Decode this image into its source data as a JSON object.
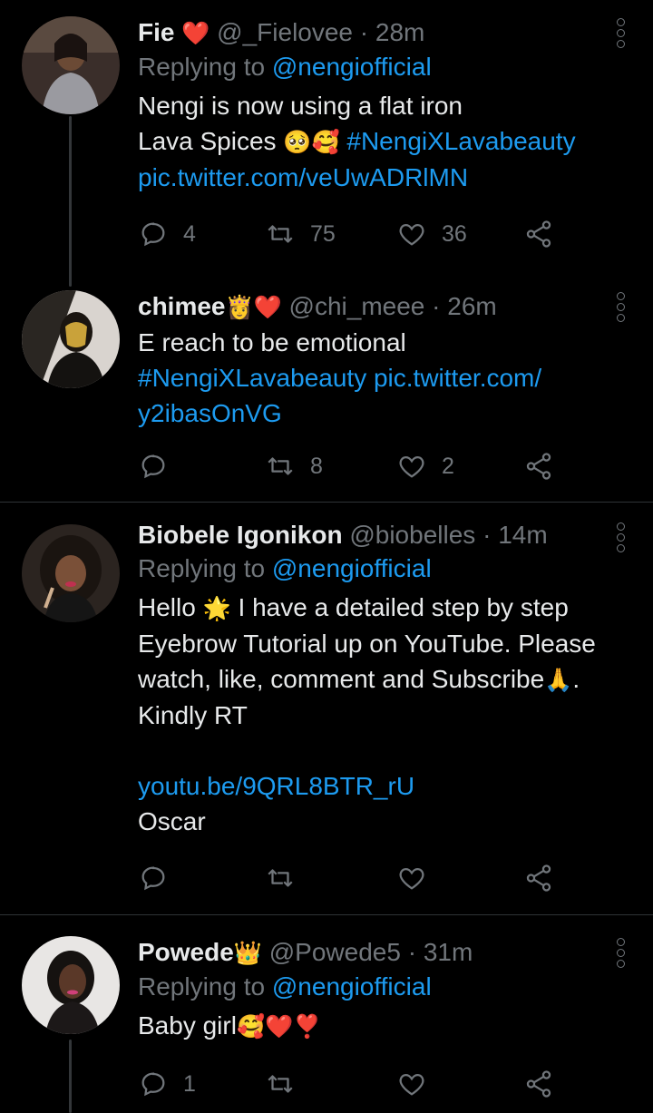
{
  "tweets": [
    {
      "name": "Fie",
      "name_emoji": "❤️",
      "handle": "@_Fielovee",
      "time": "28m",
      "replying_label": "Replying to",
      "replying_to": "@nengiofficial",
      "body_lines": [
        "Nengi is now using a flat iron",
        "Lava Spices"
      ],
      "body_emoji": "🥺🥰",
      "hashtag": "#NengiXLavabeauty",
      "link": "pic.twitter.com/veUwADRlMN",
      "replies": "4",
      "retweets": "75",
      "likes": "36"
    },
    {
      "name": "chimee",
      "name_emoji": "👸❤️",
      "handle": "@chi_meee",
      "time": "26m",
      "body_line1": "E reach to be emotional",
      "hashtag": "#NengiXLavabeauty",
      "link1": "pic.twitter.com/",
      "link2": "y2ibasOnVG",
      "replies": "",
      "retweets": "8",
      "likes": "2"
    },
    {
      "name": "Biobele Igonikon",
      "handle": "@biobelles",
      "time": "14m",
      "replying_label": "Replying to",
      "replying_to": "@nengiofficial",
      "line1_a": "Hello",
      "line1_emoji": "🌟",
      "line1_b": "I have a detailed step by step",
      "line2": "Eyebrow Tutorial up on YouTube. Please",
      "line3": "watch, like, comment and Subscribe",
      "line3_emoji": "🙏",
      "line3_end": ".",
      "line4": "Kindly RT",
      "link": "youtu.be/9QRL8BTR_rU",
      "line6": "Oscar",
      "replies": "",
      "retweets": "",
      "likes": ""
    },
    {
      "name": "Powede",
      "name_emoji": "👑",
      "handle": "@Powede5",
      "time": "31m",
      "replying_label": "Replying to",
      "replying_to": "@nengiofficial",
      "body": "Baby girl",
      "body_emoji": "🥰❤️❣️",
      "replies": "1",
      "retweets": "",
      "likes": ""
    }
  ],
  "separator": "·",
  "colors": {
    "link": "#1d9bf0",
    "muted": "#71767b",
    "background": "#000000",
    "divider": "#2f3336"
  }
}
